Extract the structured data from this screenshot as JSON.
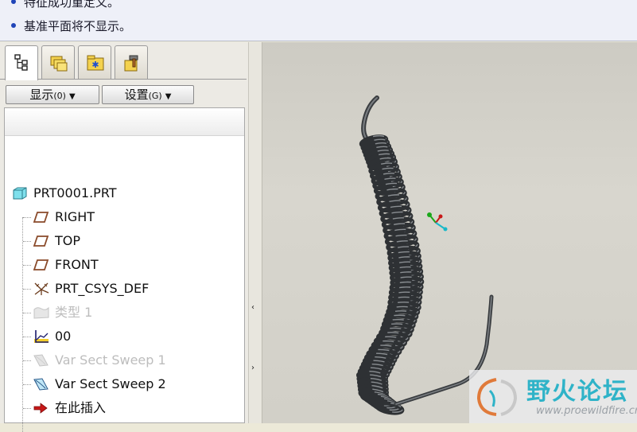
{
  "messages": [
    "特征成功重定义。",
    "基准平面将不显示。"
  ],
  "toolbar": {
    "show_label": "显示",
    "show_shortcut": "(0)",
    "settings_label": "设置",
    "settings_shortcut": "(G)"
  },
  "tabs": [
    {
      "name": "model-tree",
      "icon": "model-tree-icon",
      "active": true
    },
    {
      "name": "folder-browser",
      "icon": "folder-browser-icon",
      "active": false
    },
    {
      "name": "favorites",
      "icon": "favorites-icon",
      "active": false
    },
    {
      "name": "tools",
      "icon": "tools-icon",
      "active": false
    }
  ],
  "tree": {
    "root": "PRT0001.PRT",
    "items": [
      {
        "label": "RIGHT",
        "icon": "datum-plane-icon",
        "suppressed": false
      },
      {
        "label": "TOP",
        "icon": "datum-plane-icon",
        "suppressed": false
      },
      {
        "label": "FRONT",
        "icon": "datum-plane-icon",
        "suppressed": false
      },
      {
        "label": "PRT_CSYS_DEF",
        "icon": "csys-icon",
        "suppressed": false
      },
      {
        "label": "类型 1",
        "icon": "surface-icon",
        "suppressed": true
      },
      {
        "label": "00",
        "icon": "datum-graph-icon",
        "suppressed": false
      },
      {
        "label": "Var Sect Sweep 1",
        "icon": "sweep-icon",
        "suppressed": true
      },
      {
        "label": "Var Sect Sweep 2",
        "icon": "sweep-icon",
        "suppressed": false
      },
      {
        "label": "在此插入",
        "icon": "insert-here-icon",
        "suppressed": false
      }
    ]
  },
  "splitter": {
    "collapse_arrow": "‹",
    "expand_arrow": "›"
  },
  "watermark": {
    "title": "野火论坛",
    "url": "www.proewildfire.cn"
  }
}
